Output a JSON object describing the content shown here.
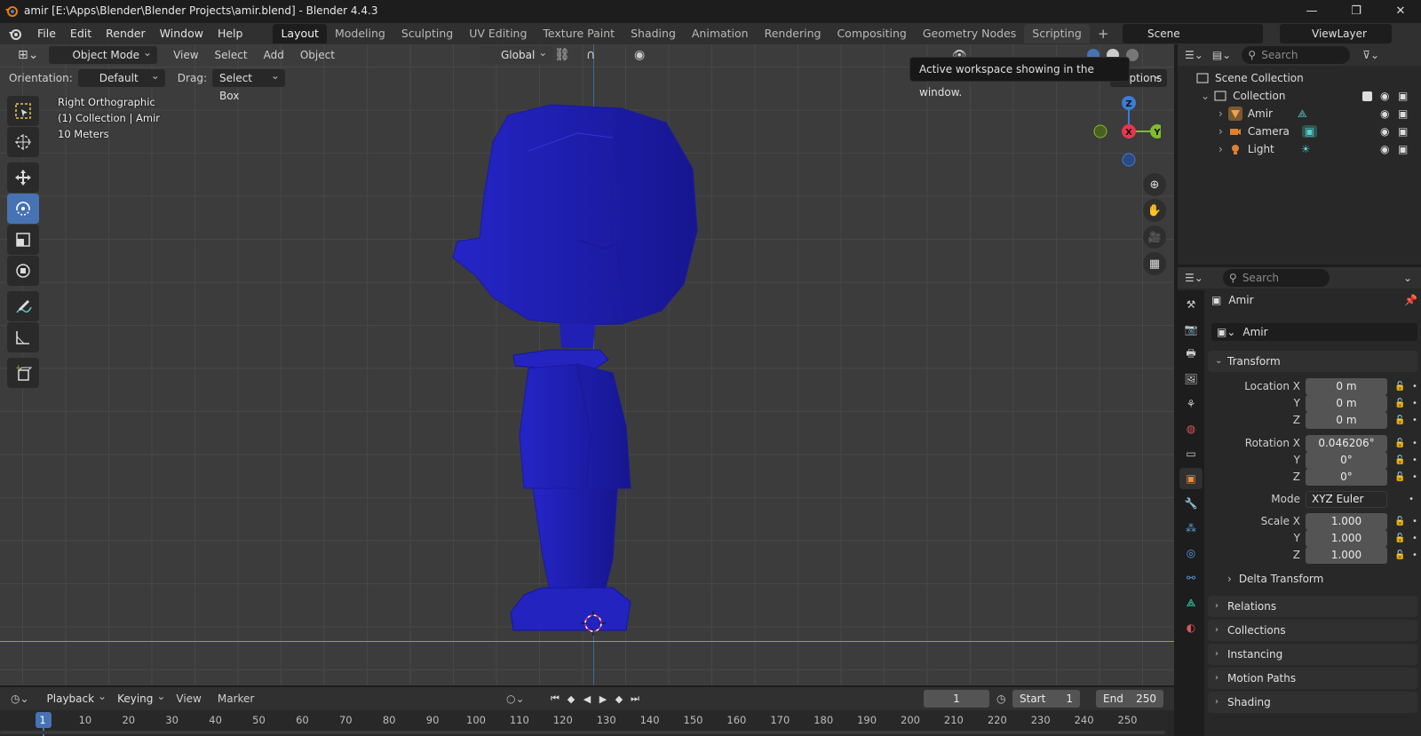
{
  "window": {
    "title": "amir [E:\\Apps\\Blender\\Blender Projects\\amir.blend] - Blender 4.4.3"
  },
  "menu": [
    "File",
    "Edit",
    "Render",
    "Window",
    "Help"
  ],
  "workspaces": [
    "Layout",
    "Modeling",
    "Sculpting",
    "UV Editing",
    "Texture Paint",
    "Shading",
    "Animation",
    "Rendering",
    "Compositing",
    "Geometry Nodes",
    "Scripting"
  ],
  "scene": {
    "name": "Scene",
    "view_layer": "ViewLayer"
  },
  "viewport_header": {
    "mode": "Object Mode",
    "menus": [
      "View",
      "Select",
      "Add",
      "Object"
    ],
    "transform_orientation": "Global",
    "options_label": "Options"
  },
  "tool_settings": {
    "orientation_label": "Orientation:",
    "orientation_value": "Default",
    "drag_label": "Drag:",
    "drag_value": "Select Box"
  },
  "viewport_info": {
    "view_name": "Right Orthographic",
    "collection_info": "(1) Collection | Amir",
    "scale": "10 Meters"
  },
  "tooltip": "Active workspace showing in the window.",
  "gizmo": {
    "z": "Z",
    "x": "X",
    "y": "Y"
  },
  "outliner": {
    "search_placeholder": "Search",
    "root": "Scene Collection",
    "collection": "Collection",
    "objects": [
      "Amir",
      "Camera",
      "Light"
    ]
  },
  "properties": {
    "search_placeholder": "Search",
    "object_name": "Amir",
    "object_field": "Amir",
    "transform_title": "Transform",
    "location": {
      "label_x": "Location X",
      "x": "0 m",
      "y": "0 m",
      "z": "0 m"
    },
    "rotation": {
      "label_x": "Rotation X",
      "x": "0.046206°",
      "y": "0°",
      "z": "0°"
    },
    "mode_label": "Mode",
    "mode_value": "XYZ Euler",
    "scale": {
      "label_x": "Scale X",
      "x": "1.000",
      "y": "1.000",
      "z": "1.000"
    },
    "axis_y": "Y",
    "axis_z": "Z",
    "delta_transform": "Delta Transform",
    "panels": [
      "Relations",
      "Collections",
      "Instancing",
      "Motion Paths",
      "Shading"
    ]
  },
  "timeline": {
    "menus": [
      "Playback",
      "Keying",
      "View",
      "Marker"
    ],
    "current_frame": "1",
    "start_label": "Start",
    "start_value": "1",
    "end_label": "End",
    "end_value": "250",
    "ruler": [
      "1",
      "10",
      "20",
      "30",
      "40",
      "50",
      "60",
      "70",
      "80",
      "90",
      "100",
      "110",
      "120",
      "130",
      "140",
      "150",
      "160",
      "170",
      "180",
      "190",
      "200",
      "210",
      "220",
      "230",
      "240",
      "250"
    ]
  },
  "colors": {
    "accent": "#4772b3",
    "model": "#2a2ab8",
    "x_axis": "#e8364f",
    "y_axis": "#7fbd2a",
    "z_axis": "#3b7cd6"
  }
}
